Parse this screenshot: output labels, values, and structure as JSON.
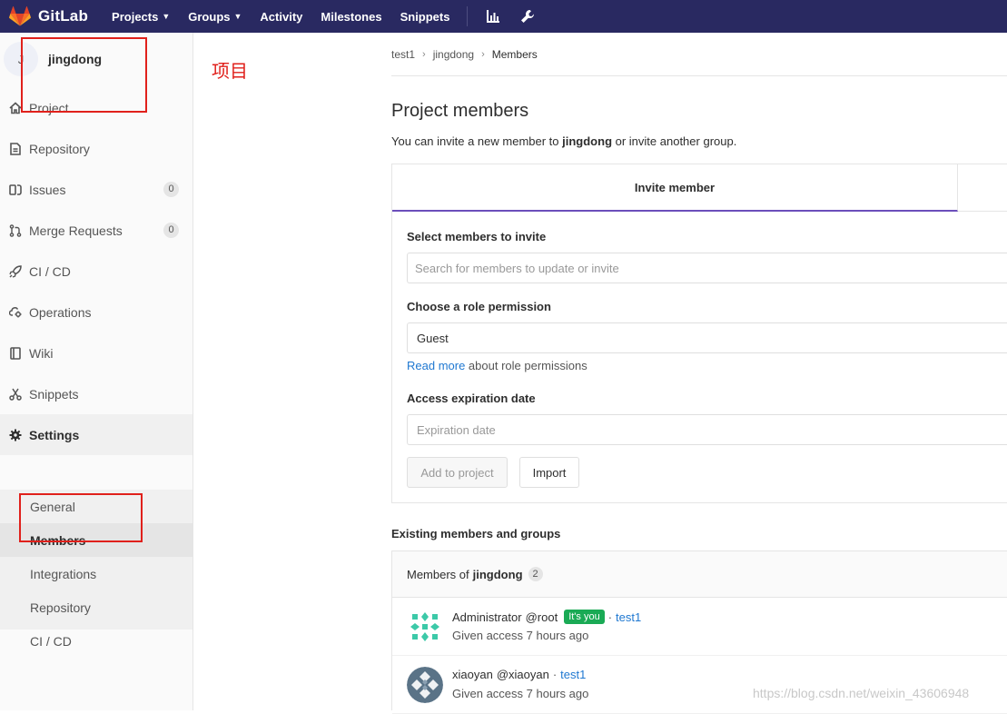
{
  "topnav": {
    "brand": "GitLab",
    "links": [
      {
        "label": "Projects",
        "dropdown": true
      },
      {
        "label": "Groups",
        "dropdown": true
      },
      {
        "label": "Activity",
        "dropdown": false
      },
      {
        "label": "Milestones",
        "dropdown": false
      },
      {
        "label": "Snippets",
        "dropdown": false
      }
    ],
    "bg_color": "#292961"
  },
  "sidebar": {
    "project_name": "jingdong",
    "items": [
      {
        "label": "Project",
        "icon": "home-icon"
      },
      {
        "label": "Repository",
        "icon": "doc-icon"
      },
      {
        "label": "Issues",
        "icon": "issues-icon",
        "count": "0"
      },
      {
        "label": "Merge Requests",
        "icon": "merge-icon",
        "count": "0"
      },
      {
        "label": "CI / CD",
        "icon": "rocket-icon"
      },
      {
        "label": "Operations",
        "icon": "cloud-gear-icon"
      },
      {
        "label": "Wiki",
        "icon": "book-icon"
      },
      {
        "label": "Snippets",
        "icon": "scissors-icon"
      },
      {
        "label": "Settings",
        "icon": "gear-icon"
      }
    ],
    "settings_sub": [
      {
        "label": "General"
      },
      {
        "label": "Members"
      },
      {
        "label": "Integrations"
      },
      {
        "label": "Repository"
      },
      {
        "label": "CI / CD"
      }
    ]
  },
  "annotation": {
    "text": "项目",
    "color": "#e0201b"
  },
  "breadcrumb": [
    "test1",
    "jingdong",
    "Members"
  ],
  "page": {
    "title": "Project members",
    "lead_prefix": "You can invite a new member to ",
    "lead_project": "jingdong",
    "lead_suffix": " or invite another group."
  },
  "invite": {
    "tab_label": "Invite member",
    "select_label": "Select members to invite",
    "search_placeholder": "Search for members to update or invite",
    "role_label": "Choose a role permission",
    "role_value": "Guest",
    "help_link": "Read more",
    "help_suffix": " about role permissions",
    "expiry_label": "Access expiration date",
    "expiry_placeholder": "Expiration date",
    "add_button": "Add to project",
    "import_button": "Import"
  },
  "existing": {
    "section_title": "Existing members and groups",
    "header_prefix": "Members of",
    "header_project": "jingdong",
    "header_count": "2",
    "members": [
      {
        "name": "Administrator",
        "username": "@root",
        "badge": "It's you",
        "source": "test1",
        "given": "Given access 7 hours ago"
      },
      {
        "name": "xiaoyan",
        "username": "@xiaoyan",
        "badge": "",
        "source": "test1",
        "given": "Given access 7 hours ago"
      }
    ]
  },
  "watermark": "https://blog.csdn.net/weixin_43606948"
}
